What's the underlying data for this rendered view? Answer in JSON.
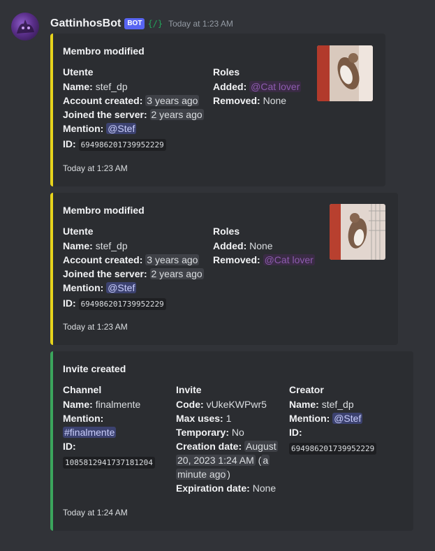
{
  "message": {
    "username": "GattinhosBot",
    "bot_badge": "BOT",
    "app_icon": "{/}",
    "timestamp": "Today at 1:23 AM"
  },
  "embeds": [
    {
      "title": "Membro modified",
      "color": "#e6d31c",
      "user_field": {
        "name": "Utente",
        "name_label": "Name",
        "name_value": "stef_dp",
        "created_label": "Account created",
        "created_value": "3 years ago",
        "joined_label": "Joined the server",
        "joined_value": "2 years ago",
        "mention_label": "Mention",
        "mention_value": "@Stef",
        "id_label": "ID",
        "id_value": "694986201739952229"
      },
      "roles_field": {
        "name": "Roles",
        "added_label": "Added",
        "added_value": "@Cat lover",
        "removed_label": "Removed",
        "removed_value": "None"
      },
      "footer": "Today at 1:23 AM"
    },
    {
      "title": "Membro modified",
      "color": "#e6d31c",
      "user_field": {
        "name": "Utente",
        "name_label": "Name",
        "name_value": "stef_dp",
        "created_label": "Account created",
        "created_value": "3 years ago",
        "joined_label": "Joined the server",
        "joined_value": "2 years ago",
        "mention_label": "Mention",
        "mention_value": "@Stef",
        "id_label": "ID",
        "id_value": "694986201739952229"
      },
      "roles_field": {
        "name": "Roles",
        "added_label": "Added",
        "added_value": "None",
        "removed_label": "Removed",
        "removed_value": "@Cat lover"
      },
      "footer": "Today at 1:23 AM"
    },
    {
      "title": "Invite created",
      "color": "#3ba55c",
      "channel_field": {
        "name": "Channel",
        "name_label": "Name",
        "name_value": "finalmente",
        "mention_label": "Mention",
        "mention_value": "#finalmente",
        "id_label": "ID",
        "id_value": "1085812941737181204"
      },
      "invite_field": {
        "name": "Invite",
        "code_label": "Code",
        "code_value": "vUkeKWPwr5",
        "max_uses_label": "Max uses",
        "max_uses_value": "1",
        "temporary_label": "Temporary",
        "temporary_value": "No",
        "creation_label": "Creation date",
        "creation_value_1": "August",
        "creation_value_2": "20, 2023 1:24 AM",
        "creation_value_3": "a",
        "creation_value_4": "minute ago",
        "expiration_label": "Expiration date",
        "expiration_value": "None"
      },
      "creator_field": {
        "name": "Creator",
        "name_label": "Name",
        "name_value": "stef_dp",
        "mention_label": "Mention",
        "mention_value": "@Stef",
        "id_label": "ID",
        "id_value": "694986201739952229"
      },
      "footer": "Today at 1:24 AM"
    }
  ]
}
